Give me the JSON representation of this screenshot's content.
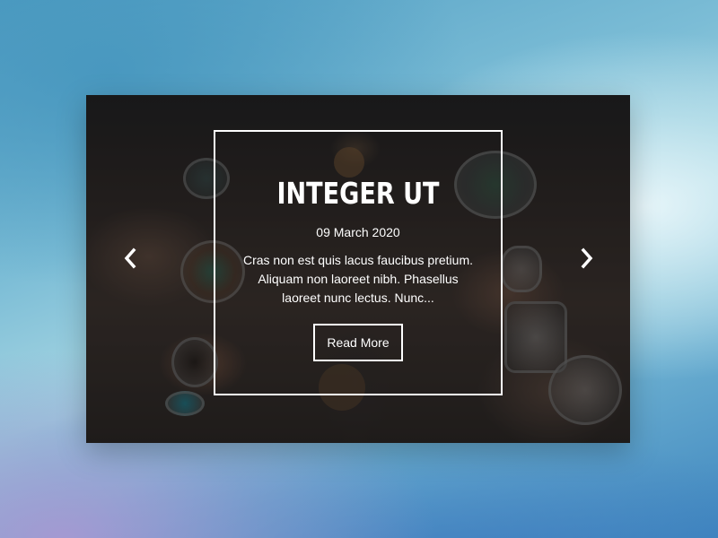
{
  "slider": {
    "slide": {
      "title": "INTEGER UT",
      "date": "09 March 2020",
      "excerpt": "Cras non est quis lacus faucibus pretium. Aliquam non laoreet nibh. Phasellus laoreet nunc lectus. Nunc...",
      "button_label": "Read More",
      "image_description_icon": "photo-hands-rings"
    },
    "prev_icon": "chevron-left-icon",
    "next_icon": "chevron-right-icon"
  },
  "colors": {
    "text": "#ffffff",
    "frame_border": "#ffffff",
    "overlay": "rgba(0,0,0,0.42)"
  }
}
